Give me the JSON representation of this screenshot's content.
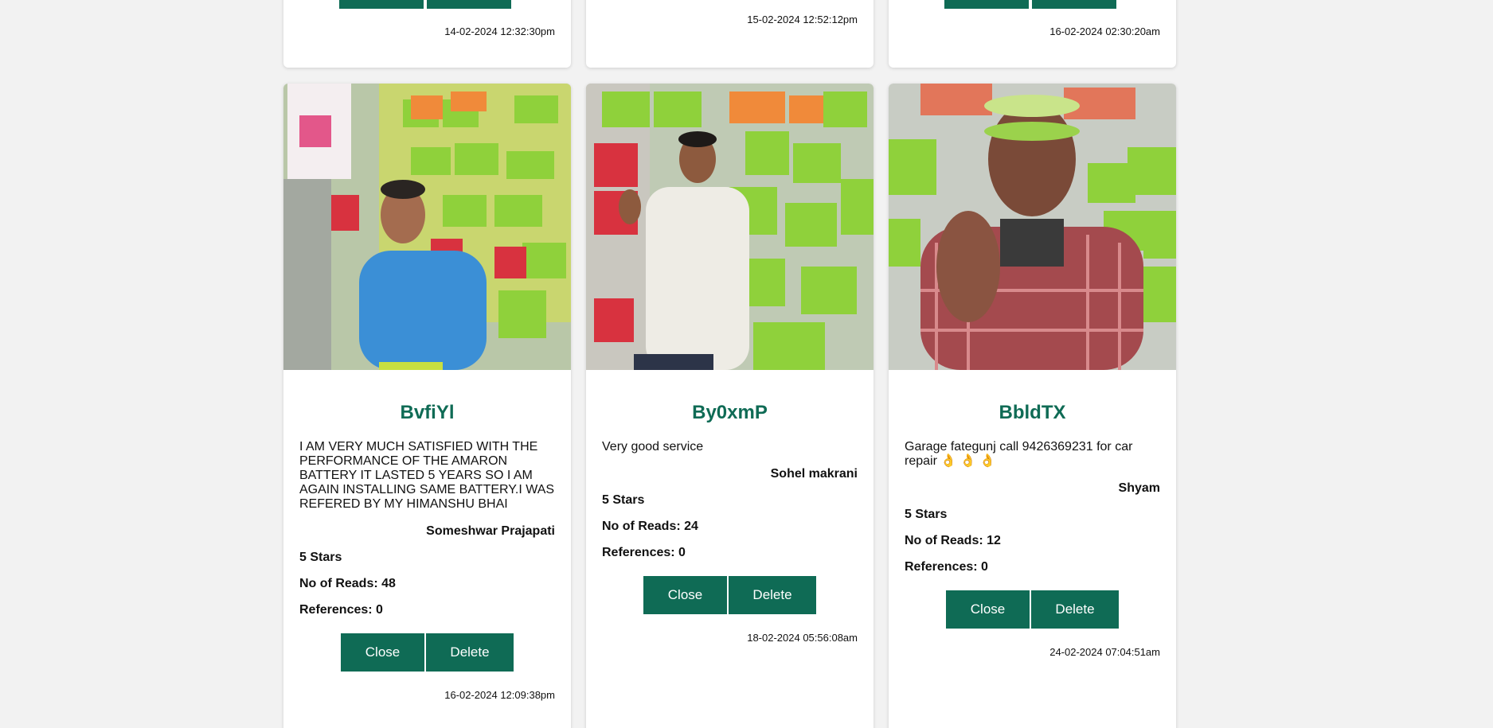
{
  "top_cards": [
    {
      "timestamp": "14-02-2024 12:32:30pm"
    },
    {
      "timestamp": "15-02-2024 12:52:12pm"
    },
    {
      "timestamp": "16-02-2024 02:30:20am"
    }
  ],
  "cards": [
    {
      "code": "BvfiYl",
      "review": "I AM VERY MUCH SATISFIED WITH THE PERFORMANCE OF THE AMARON BATTERY IT LASTED 5 YEARS SO I AM AGAIN INSTALLING SAME BATTERY.I WAS REFERED BY MY HIMANSHU BHAI",
      "reviewer": "Someshwar Prajapati",
      "stars": "5 Stars",
      "reads": "No of Reads: 48",
      "references": "References: 0",
      "close_label": "Close",
      "delete_label": "Delete",
      "timestamp": "16-02-2024 12:09:38pm"
    },
    {
      "code": "By0xmP",
      "review": "Very good service",
      "reviewer": "Sohel makrani",
      "stars": "5 Stars",
      "reads": "No of Reads: 24",
      "references": "References: 0",
      "close_label": "Close",
      "delete_label": "Delete",
      "timestamp": "18-02-2024 05:56:08am"
    },
    {
      "code": "BbldTX",
      "review": "Garage fategunj call 9426369231 for car repair 👌 👌 👌",
      "reviewer": "Shyam",
      "stars": "5 Stars",
      "reads": "No of Reads: 12",
      "references": "References: 0",
      "close_label": "Close",
      "delete_label": "Delete",
      "timestamp": "24-02-2024 07:04:51am"
    }
  ],
  "colors": {
    "brand": "#0f6b55",
    "background": "#f2f2f2"
  }
}
